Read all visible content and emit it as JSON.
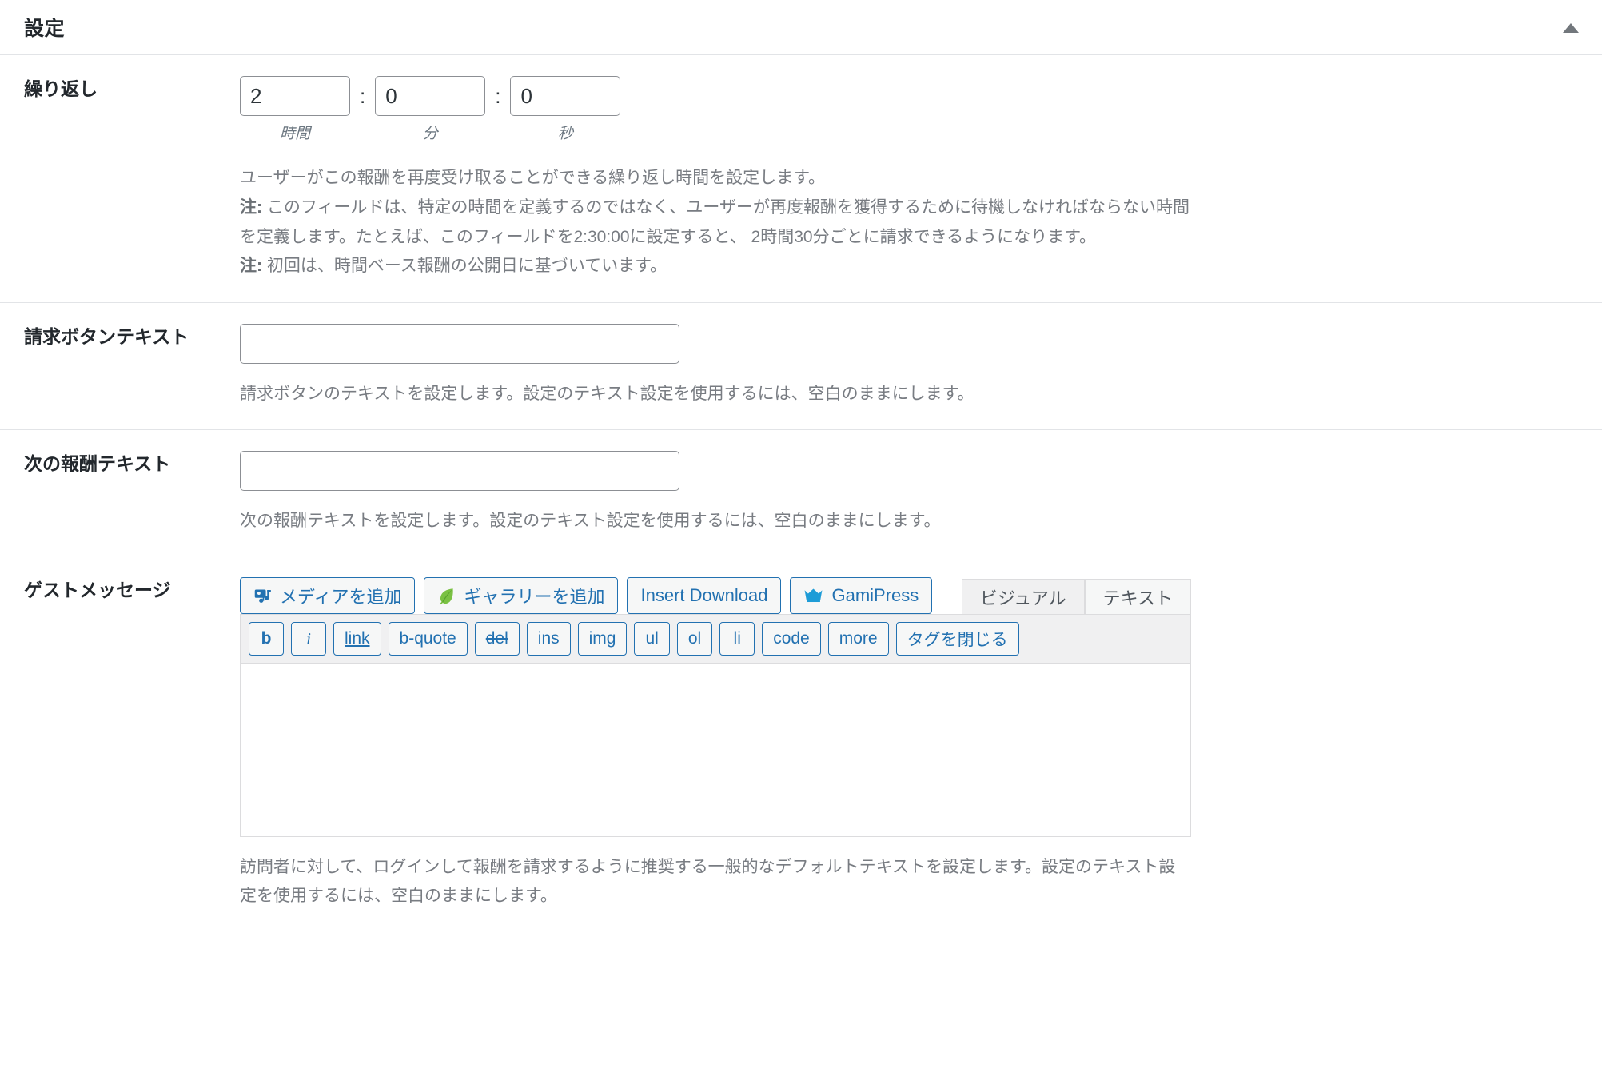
{
  "panel": {
    "title": "設定",
    "collapse_icon": "triangle-up-icon"
  },
  "rows": {
    "repeat": {
      "label": "繰り返し",
      "hours": {
        "value": "2",
        "caption": "時間"
      },
      "minutes": {
        "value": "0",
        "caption": "分"
      },
      "seconds": {
        "value": "0",
        "caption": "秒"
      },
      "separator": ":",
      "desc_line1": "ユーザーがこの報酬を再度受け取ることができる繰り返し時間を設定します。",
      "note1_label": "注:",
      "note1_text": "このフィールドは、特定の時間を定義するのではなく、ユーザーが再度報酬を獲得するために待機しなければならない時間を定義します。たとえば、このフィールドを2:30:00に設定すると、 2時間30分ごとに請求できるようになります。",
      "note2_label": "注:",
      "note2_text": "初回は、時間ベース報酬の公開日に基づいています。"
    },
    "claim_button_text": {
      "label": "請求ボタンテキスト",
      "value": "",
      "desc": "請求ボタンのテキストを設定します。設定のテキスト設定を使用するには、空白のままにします。"
    },
    "next_reward_text": {
      "label": "次の報酬テキスト",
      "value": "",
      "desc": "次の報酬テキストを設定します。設定のテキスト設定を使用するには、空白のままにします。"
    },
    "guest_message": {
      "label": "ゲストメッセージ",
      "value": "",
      "desc": "訪問者に対して、ログインして報酬を請求するように推奨する一般的なデフォルトテキストを設定します。設定のテキスト設定を使用するには、空白のままにします。"
    }
  },
  "editor": {
    "media_buttons": [
      {
        "label": "メディアを追加",
        "icon": "media-icon"
      },
      {
        "label": "ギャラリーを追加",
        "icon": "leaf-icon"
      },
      {
        "label": "Insert Download",
        "icon": "none"
      },
      {
        "label": "GamiPress",
        "icon": "crown-icon"
      }
    ],
    "tabs": [
      {
        "label": "ビジュアル",
        "state": "inactive"
      },
      {
        "label": "テキスト",
        "state": "active"
      }
    ],
    "quicktags": [
      {
        "label": "b",
        "style": "bold"
      },
      {
        "label": "i",
        "style": "italic"
      },
      {
        "label": "link",
        "style": "underline"
      },
      {
        "label": "b-quote",
        "style": "plain"
      },
      {
        "label": "del",
        "style": "strike"
      },
      {
        "label": "ins",
        "style": "plain"
      },
      {
        "label": "img",
        "style": "plain"
      },
      {
        "label": "ul",
        "style": "plain"
      },
      {
        "label": "ol",
        "style": "plain"
      },
      {
        "label": "li",
        "style": "plain"
      },
      {
        "label": "code",
        "style": "plain"
      },
      {
        "label": "more",
        "style": "plain"
      },
      {
        "label": "タグを閉じる",
        "style": "plain"
      }
    ]
  },
  "colors": {
    "link_blue": "#2271b1",
    "gamipress_blue": "#1e9cd7",
    "leaf_green": "#7ac143",
    "text_dark": "#23282d",
    "text_muted": "#787c82",
    "border": "#8c8f94"
  }
}
